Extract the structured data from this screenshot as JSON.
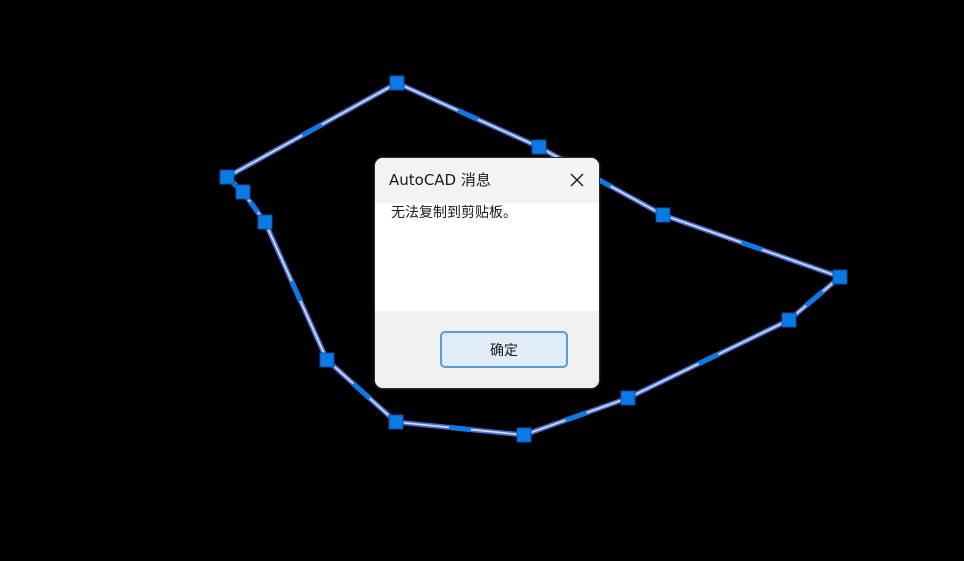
{
  "drawing": {
    "entity": "polyline",
    "selected": true,
    "line_color": "#d6e4ff",
    "glow_color": "#4a6ed8",
    "grip_color": "#0a7ae6"
  },
  "dialog": {
    "title": "AutoCAD 消息",
    "message": "无法复制到剪贴板。",
    "ok_label": "确定",
    "close_icon": "close-icon"
  },
  "colors": {
    "background": "#000000",
    "titlebar": "#f3f3f3",
    "footer": "#f0f0f0",
    "button_fill": "#e0ecf8",
    "button_border": "#5b9bd5"
  }
}
